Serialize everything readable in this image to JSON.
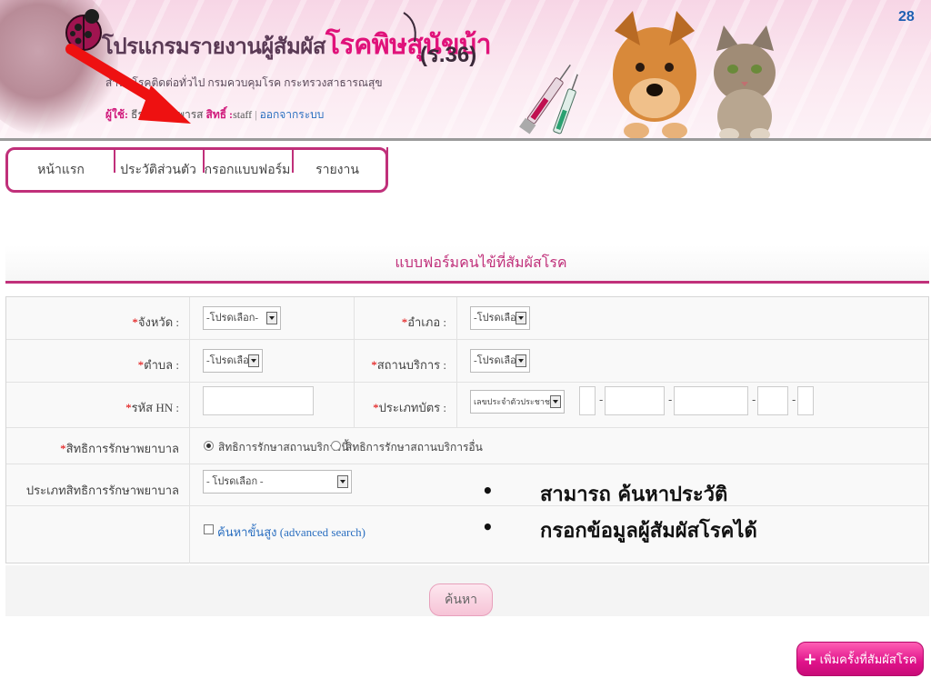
{
  "page_number": "28",
  "header": {
    "app_title_prefix": "โปรแกรมรายงานผู้สัมผัส",
    "app_title_accent": "โรคพิษสุนัขบ้า",
    "app_code": "(ร.36)",
    "subtitle": "สำนักโรคติดต่อทั่วไป กรมควบคุมโรค กระทรวงสาธารณสุข",
    "user_label": "ผู้ใช้:",
    "user_name": "ธีรภัทร เทพารส",
    "role_label": "สิทธิ์ :",
    "role_value": "staff",
    "logout_label": "ออกจากระบบ"
  },
  "nav": {
    "items": [
      {
        "label": "หน้าแรก"
      },
      {
        "label": "ประวัติส่วนตัว"
      },
      {
        "label": "กรอกแบบฟอร์ม"
      },
      {
        "label": "รายงาน"
      }
    ]
  },
  "form": {
    "heading": "แบบฟอร์มคนไข้ที่สัมผัสโรค",
    "required_mark": "*",
    "province_label": "จังหวัด :",
    "province_value": "-โปรดเลือก-",
    "district_label": "อำเภอ :",
    "district_value": "-โปรดเลือก-",
    "subdistrict_label": "ตำบล :",
    "subdistrict_value": "-โปรดเลือก-",
    "facility_label": "สถานบริการ :",
    "facility_value": "-โปรดเลือก-",
    "hn_label": "รหัส HN :",
    "hn_value": "",
    "card_type_label": "ประเภทบัตร :",
    "card_type_value": "เลขประจำตัวประชาชน",
    "card_separator": "-",
    "rights_label": "สิทธิการรักษาพยาบาล",
    "rights_option_this": "สิทธิการรักษาสถานบริการนี้",
    "rights_option_other": "สิทธิการรักษาสถานบริการอื่น",
    "rights_type_label": "ประเภทสิทธิการรักษาพยาบาล",
    "rights_type_value": "- โปรดเลือก -",
    "advanced_search_label": "ค้นหาขั้นสูง (advanced search)"
  },
  "notes": [
    {
      "bullet": "•",
      "text": "สามารถ ค้นหาประวัติ"
    },
    {
      "bullet": "•",
      "text": "กรอกข้อมูลผู้สัมผัสโรคได้"
    }
  ],
  "buttons": {
    "search_label": "ค้นหา",
    "add_plus": "+",
    "add_contact_label": "เพิ่มครั้งที่สัมผัสโรค"
  },
  "colors": {
    "accent": "#c0307a",
    "brand_pink": "#e0127a",
    "link": "#2b6fc0",
    "required": "#e00000",
    "arrow": "#ee1111"
  },
  "icons": [
    "ladybug-logo-icon",
    "red-arrow-icon",
    "syringe-icon",
    "dog-image",
    "cat-image",
    "dropdown-arrow-icon",
    "plus-icon"
  ]
}
